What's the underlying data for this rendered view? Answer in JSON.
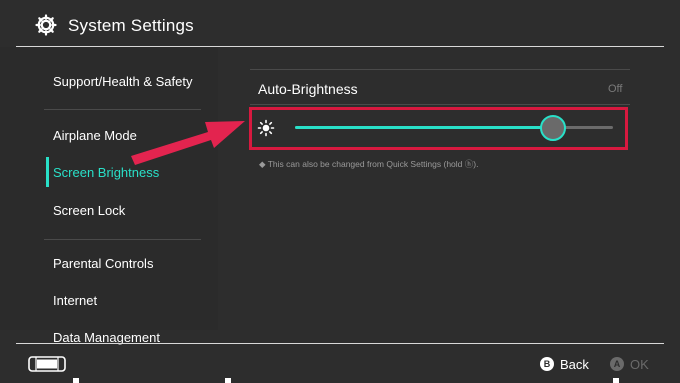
{
  "header": {
    "title": "System Settings",
    "icon": "gear-icon"
  },
  "sidebar": {
    "items": [
      {
        "label": "Support/Health & Safety",
        "active": false
      },
      {
        "label": "Airplane Mode",
        "active": false
      },
      {
        "label": "Screen Brightness",
        "active": true
      },
      {
        "label": "Screen Lock",
        "active": false
      },
      {
        "label": "Parental Controls",
        "active": false
      },
      {
        "label": "Internet",
        "active": false
      },
      {
        "label": "Data Management",
        "active": false
      }
    ]
  },
  "main": {
    "auto_brightness": {
      "label": "Auto-Brightness",
      "value": "Off"
    },
    "brightness_slider": {
      "icon": "sun-icon",
      "level": 0.81
    },
    "hint": "◆ This can also be changed from Quick Settings (hold ⓗ)."
  },
  "footer": {
    "left_icon": "console-icon",
    "back": {
      "button": "B",
      "label": "Back"
    },
    "ok": {
      "button": "A",
      "label": "OK"
    }
  },
  "colors": {
    "accent": "#29e0c8",
    "highlight": "#d7193f",
    "background": "#2d2d2d"
  }
}
